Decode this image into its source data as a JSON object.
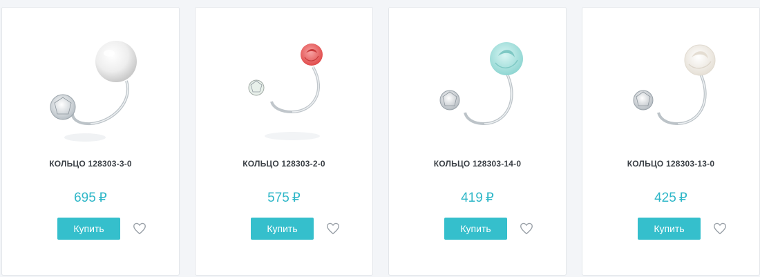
{
  "products": [
    {
      "title": "КОЛЬЦО 128303-3-0",
      "price": "695",
      "currency": "₽",
      "buy_label": "Купить",
      "stone": "pearl",
      "accent_color": "#f4f4f4"
    },
    {
      "title": "КОЛЬЦО 128303-2-0",
      "price": "575",
      "currency": "₽",
      "buy_label": "Купить",
      "stone": "rose",
      "accent_color": "#ec5f5f"
    },
    {
      "title": "КОЛЬЦО 128303-14-0",
      "price": "419",
      "currency": "₽",
      "buy_label": "Купить",
      "stone": "rose",
      "accent_color": "#a8e3e0"
    },
    {
      "title": "КОЛЬЦО 128303-13-0",
      "price": "425",
      "currency": "₽",
      "buy_label": "Купить",
      "stone": "rose",
      "accent_color": "#f6f3ee"
    }
  ],
  "colors": {
    "price": "#2fb7c8",
    "button": "#35bfcc",
    "card_border": "#e3e6ea",
    "background": "#f3f5f8"
  },
  "icons": {
    "favorite": "heart-outline-icon"
  }
}
